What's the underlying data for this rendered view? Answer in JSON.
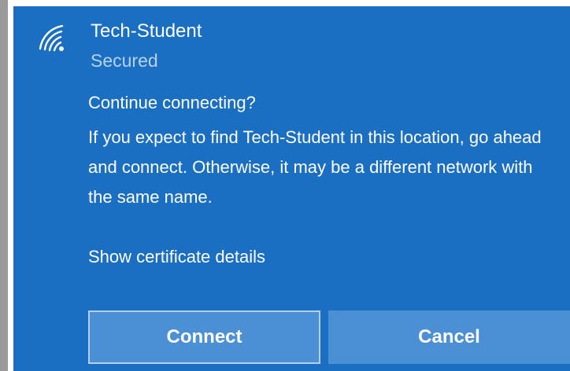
{
  "network": {
    "name": "Tech-Student",
    "status": "Secured",
    "icon": "wifi-secured-icon"
  },
  "prompt": {
    "title": "Continue connecting?",
    "body": "If you expect to find Tech-Student in this location, go ahead and connect. Otherwise, it may be a different network with the same name.",
    "certificate_link": "Show certificate details"
  },
  "buttons": {
    "connect_label": "Connect",
    "cancel_label": "Cancel"
  },
  "colors": {
    "panel_background": "#1a6fc2",
    "button_background": "#4b8fd4",
    "secondary_text": "#b8d2ee"
  }
}
